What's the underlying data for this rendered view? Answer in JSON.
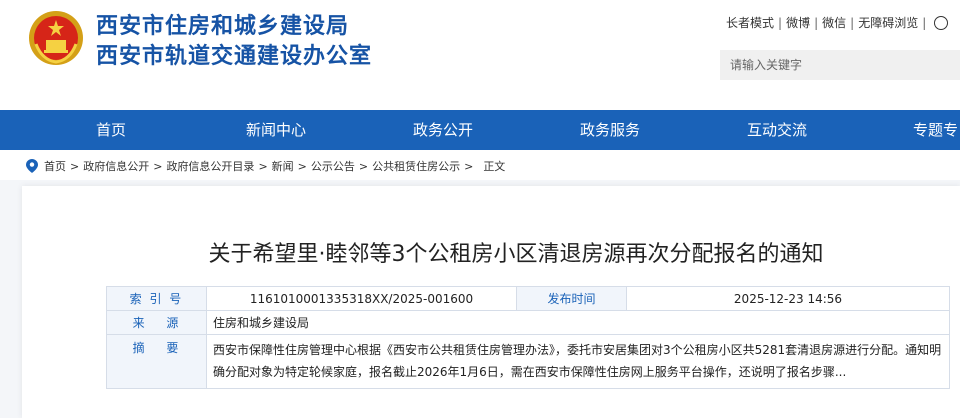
{
  "header": {
    "title_line1": "西安市住房和城乡建设局",
    "title_line2": "西安市轨道交通建设办公室",
    "top_links": [
      "长者模式",
      "微博",
      "微信",
      "无障碍浏览"
    ],
    "search_placeholder": "请输入关键字",
    "emblem_icon": "national-emblem-icon",
    "brand_color": "#1653a5"
  },
  "nav": {
    "items": [
      "首页",
      "新闻中心",
      "政务公开",
      "政务服务",
      "互动交流",
      "专题专"
    ],
    "color": "#1a62b8"
  },
  "breadcrumb": {
    "items": [
      "首页",
      "政府信息公开",
      "政府信息公开目录",
      "新闻",
      "公示公告",
      "公共租赁住房公示",
      "正文"
    ]
  },
  "article": {
    "title": "关于希望里·睦邻等3个公租房小区清退房源再次分配报名的通知",
    "meta": {
      "index_label": "索 引 号",
      "index_value": "1161010001335318XX/2025-001600",
      "date_label": "发布时间",
      "date_value": "2025-12-23 14:56",
      "source_label": "来　 源",
      "source_value": "住房和城乡建设局",
      "abstract_label": "摘　 要",
      "abstract_value": "西安市保障性住房管理中心根据《西安市公共租赁住房管理办法》，委托市安居集团对3个公租房小区共5281套清退房源进行分配。通知明确分配对象为特定轮候家庭，报名截止2026年1月6日，需在西安市保障性住房网上服务平台操作，还说明了报名步骤..."
    }
  }
}
